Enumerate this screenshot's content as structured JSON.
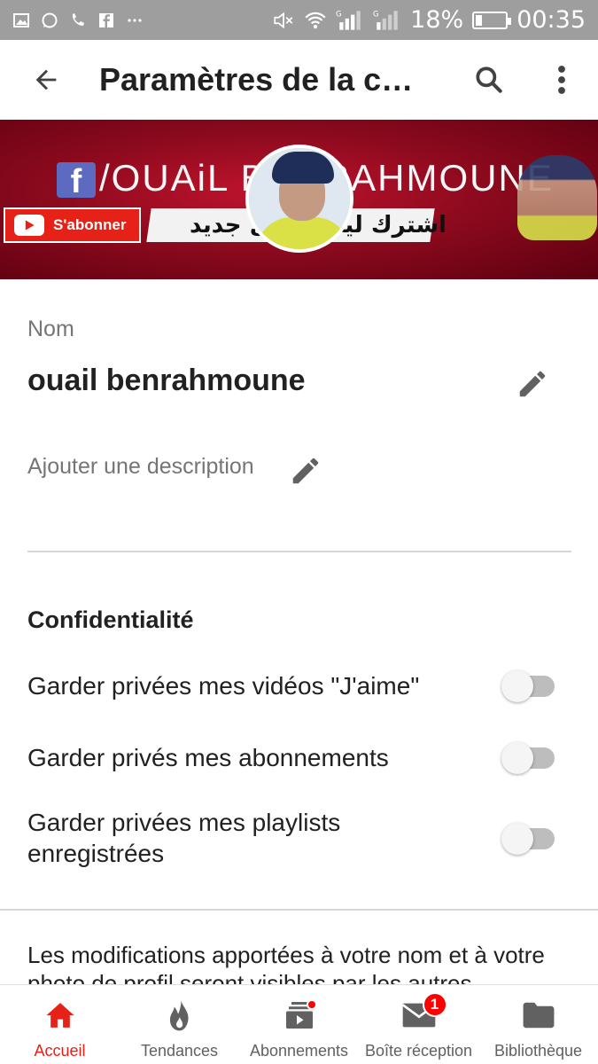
{
  "status_bar": {
    "battery": "18%",
    "time": "00:35",
    "icons_left": [
      "image-icon",
      "whatsapp-icon",
      "call-icon",
      "facebook-icon",
      "more-notifications-icon"
    ],
    "icons_right": [
      "mute-icon",
      "wifi-icon",
      "signal-sim1-icon",
      "signal-sim2-icon",
      "battery-icon"
    ],
    "text_color": "#ffffff",
    "background": "#9e9e9e"
  },
  "app_bar": {
    "title": "Paramètres de la chaîne",
    "back_icon": "arrow-back-icon",
    "search_icon": "search-icon",
    "more_icon": "more-vert-icon"
  },
  "banner": {
    "channel_name": "/OUAiL BENRAHMOUNE",
    "subscribe_label": "S'abonner",
    "arabic_text": "اشترك ليصلك كل جديد",
    "colors": {
      "primary": "#8e0a1e",
      "accent": "#e62117"
    }
  },
  "channel": {
    "name_label": "Nom",
    "name_value": "ouail benrahmoune",
    "description_placeholder": "Ajouter une description"
  },
  "privacy": {
    "title": "Confidentialité",
    "settings": [
      {
        "label": "Garder privées mes vidéos \"J'aime\"",
        "enabled": false
      },
      {
        "label": "Garder privés mes abonnements",
        "enabled": false
      },
      {
        "label": "Garder privées mes playlists enregistrées",
        "enabled": false
      }
    ]
  },
  "notice": "Les modifications apportées à votre nom et à votre photo de profil seront visibles par les autres",
  "bottom_nav": {
    "items": [
      {
        "label": "Accueil",
        "icon": "home-icon",
        "active": true
      },
      {
        "label": "Tendances",
        "icon": "flame-icon",
        "active": false
      },
      {
        "label": "Abonnements",
        "icon": "subscriptions-icon",
        "active": false,
        "dot": true
      },
      {
        "label": "Boîte réception",
        "icon": "inbox-icon",
        "active": false,
        "badge": "1"
      },
      {
        "label": "Bibliothèque",
        "icon": "folder-icon",
        "active": false
      }
    ],
    "active_color": "#e62117"
  }
}
